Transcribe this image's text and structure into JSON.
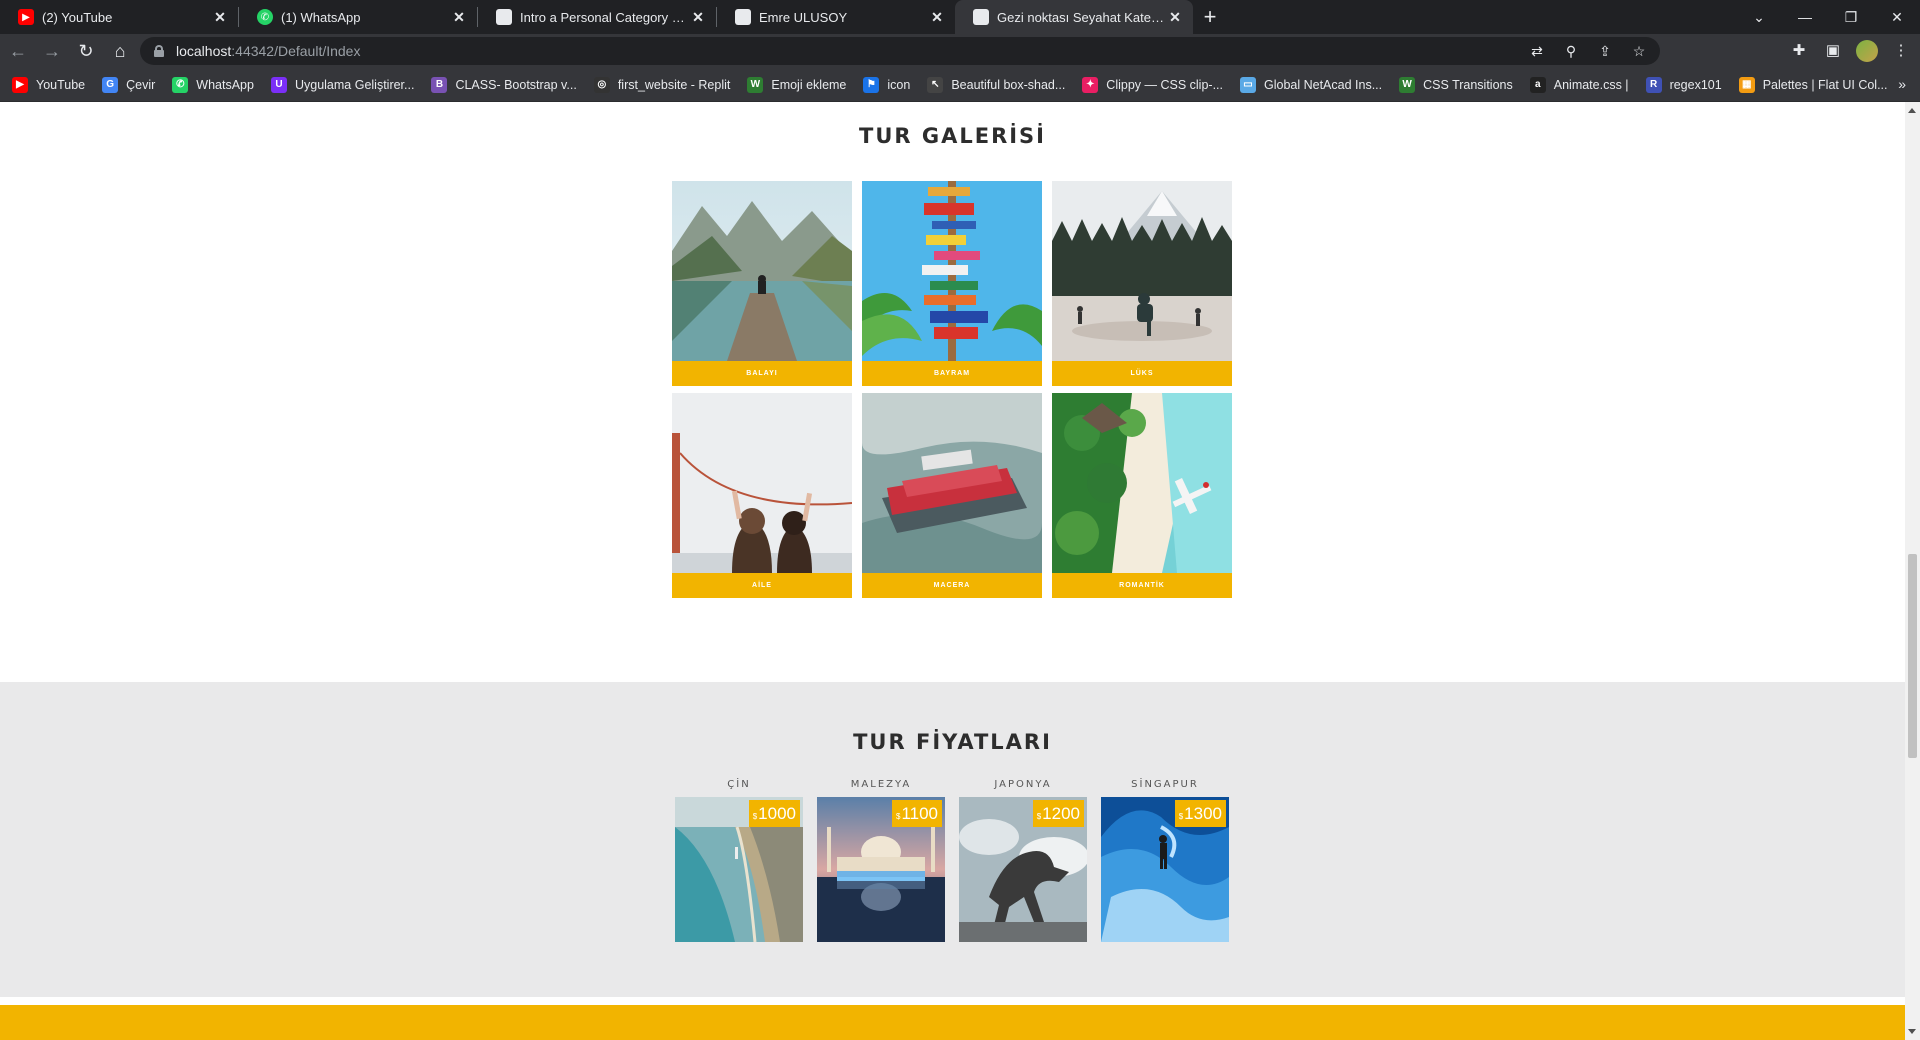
{
  "browser": {
    "tabs": [
      {
        "title": "(2) YouTube",
        "icon": "youtube-icon",
        "color": "#ff0000",
        "active": false
      },
      {
        "title": "(1) WhatsApp",
        "icon": "whatsapp-icon",
        "color": "#25d366",
        "active": false
      },
      {
        "title": "Intro a Personal Category bootstr",
        "icon": "page-icon",
        "color": "#e8eaed",
        "active": false
      },
      {
        "title": "Emre ULUSOY",
        "icon": "page-icon",
        "color": "#e8eaed",
        "active": false
      },
      {
        "title": "Gezi noktası Seyahat Kategorisi D",
        "icon": "page-icon",
        "color": "#e8eaed",
        "active": true
      }
    ],
    "url_host": "localhost",
    "url_rest": ":44342/Default/Index",
    "bookmarks": [
      {
        "label": "YouTube",
        "color": "#ff0000",
        "glyph": "▶"
      },
      {
        "label": "Çevir",
        "color": "#4285f4",
        "glyph": "G"
      },
      {
        "label": "WhatsApp",
        "color": "#25d366",
        "glyph": "✆"
      },
      {
        "label": "Uygulama Geliştirer...",
        "color": "#7b2ff7",
        "glyph": "U"
      },
      {
        "label": "CLASS- Bootstrap v...",
        "color": "#7952b3",
        "glyph": "B"
      },
      {
        "label": "first_website - Replit",
        "color": "#333333",
        "glyph": "◎"
      },
      {
        "label": "Emoji ekleme",
        "color": "#2e7d32",
        "glyph": "W"
      },
      {
        "label": "icon",
        "color": "#1a73e8",
        "glyph": "⚑"
      },
      {
        "label": "Beautiful box-shad...",
        "color": "#444444",
        "glyph": "↖"
      },
      {
        "label": "Clippy — CSS clip-...",
        "color": "#e91e63",
        "glyph": "✦"
      },
      {
        "label": "Global NetAcad Ins...",
        "color": "#5aa9e6",
        "glyph": "▭"
      },
      {
        "label": "CSS Transitions",
        "color": "#2e7d32",
        "glyph": "W"
      },
      {
        "label": "Animate.css |",
        "color": "#222222",
        "glyph": "a"
      },
      {
        "label": "regex101",
        "color": "#3f51b5",
        "glyph": "R"
      },
      {
        "label": "Palettes | Flat UI Col...",
        "color": "#f39c12",
        "glyph": "▦"
      }
    ]
  },
  "page": {
    "gallery_title": "TUR GALERİSİ",
    "gallery": [
      {
        "label": "BALAYI",
        "scene": "lake-dock"
      },
      {
        "label": "BAYRAM",
        "scene": "signpost"
      },
      {
        "label": "LÜKS",
        "scene": "ice-skating"
      },
      {
        "label": "AİLE",
        "scene": "bridge-friends"
      },
      {
        "label": "MACERA",
        "scene": "boat-falls"
      },
      {
        "label": "ROMANTİK",
        "scene": "island-seaplane"
      }
    ],
    "prices_title": "TUR FİYATLARI",
    "prices": [
      {
        "country": "ÇİN",
        "currency": "$",
        "amount": "1000",
        "scene": "coast-city"
      },
      {
        "country": "MALEZYA",
        "currency": "$",
        "amount": "1100",
        "scene": "mosque-night"
      },
      {
        "country": "JAPONYA",
        "currency": "$",
        "amount": "1200",
        "scene": "horse-statue"
      },
      {
        "country": "SİNGAPUR",
        "currency": "$",
        "amount": "1300",
        "scene": "ice-cave"
      }
    ],
    "accent_color": "#f2b400"
  }
}
